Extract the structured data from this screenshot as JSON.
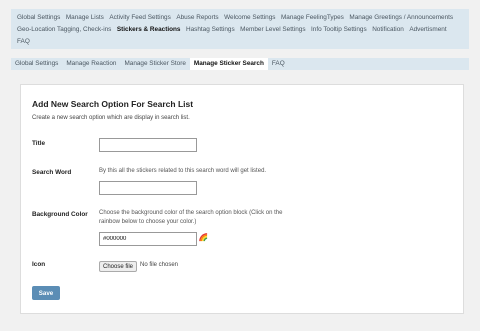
{
  "top_nav": {
    "row1": [
      "Global Settings",
      "Manage Lists",
      "Activity Feed Settings",
      "Abuse Reports",
      "Welcome Settings",
      "Manage FeelingTypes",
      "Manage Greetings / Announcements"
    ],
    "row2": [
      "Geo-Location Tagging, Check-ins",
      "Stickers & Reactions",
      "Hashtag Settings",
      "Member Level Settings",
      "Info Tooltip Settings",
      "Notification",
      "Advertisment"
    ],
    "row3": [
      "FAQ"
    ],
    "active": "Stickers & Reactions"
  },
  "sub_nav": {
    "items": [
      "Global Settings",
      "Manage Reaction",
      "Manage Sticker Store",
      "Manage Sticker Search",
      "FAQ"
    ],
    "active": "Manage Sticker Search"
  },
  "form": {
    "heading": "Add New Search Option For Search List",
    "description": "Create a new search option which are display in search list.",
    "title_label": "Title",
    "title_value": "",
    "search_word_label": "Search Word",
    "search_word_help": "By this all the stickers related to this search word will get listed.",
    "search_word_value": "",
    "bg_color_label": "Background Color",
    "bg_color_help": "Choose the background color of the search option block (Click on the rainbow below to choose your color.)",
    "bg_color_value": "#000000",
    "icon_label": "Icon",
    "choose_file_label": "Choose file",
    "no_file_text": "No file chosen",
    "save_label": "Save"
  }
}
